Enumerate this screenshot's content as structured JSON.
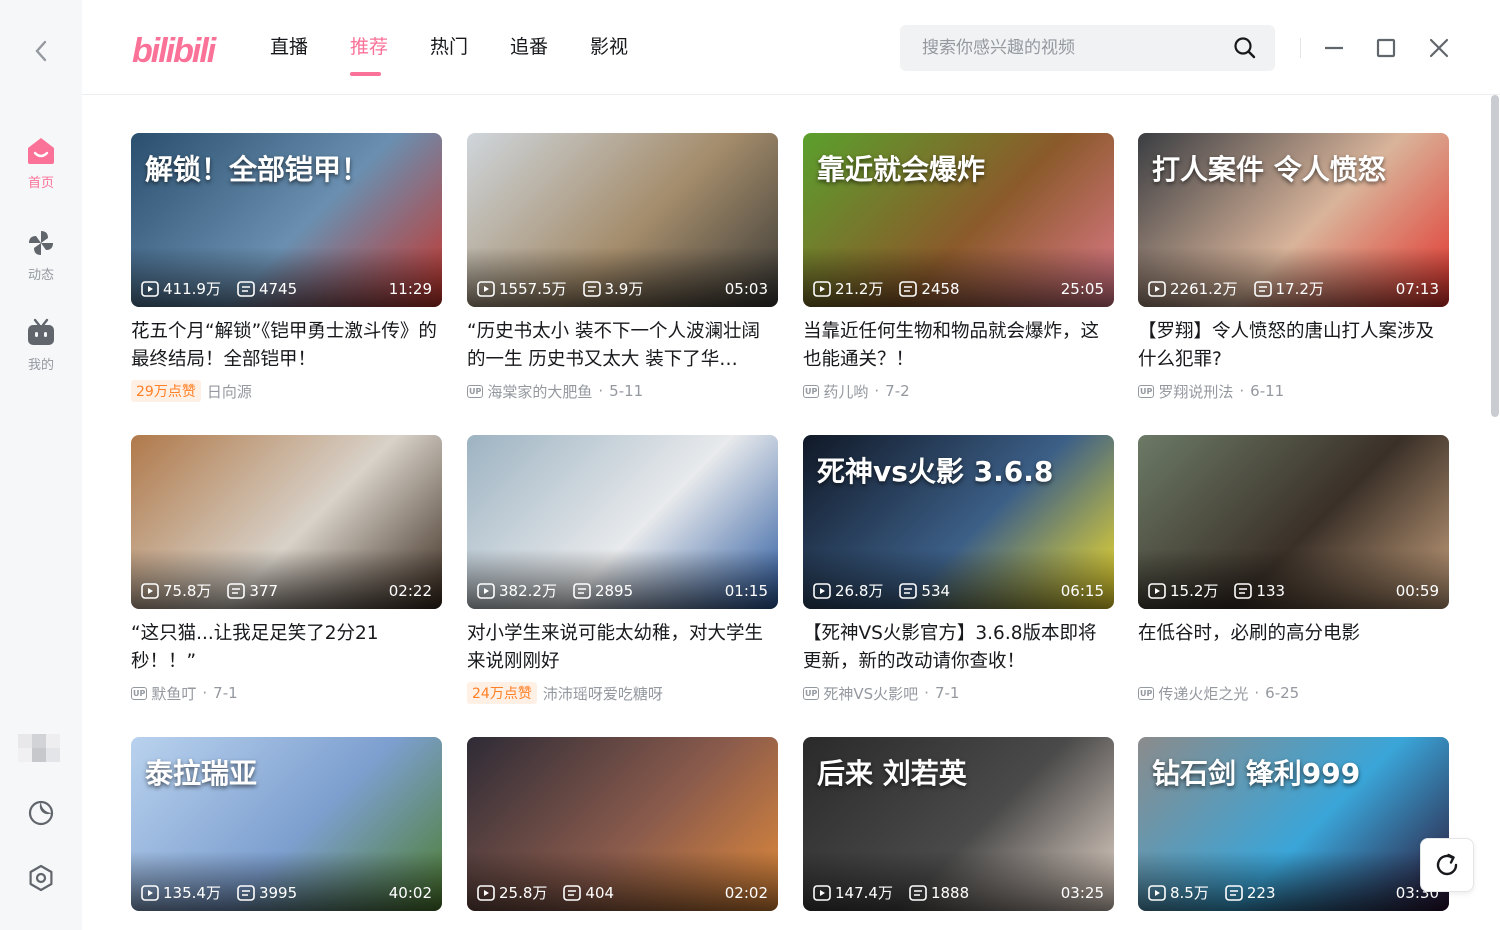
{
  "app": {
    "logo_text": "bilibili",
    "brand_color": "#fb7299"
  },
  "sidebar": {
    "back_icon": "chevron-left-icon",
    "items": [
      {
        "label": "首页",
        "icon": "home-tv-icon",
        "active": true
      },
      {
        "label": "动态",
        "icon": "pinwheel-icon",
        "active": false
      },
      {
        "label": "我的",
        "icon": "tv-face-icon",
        "active": false
      }
    ],
    "bottom_icons": [
      "theme-moon-icon",
      "settings-gear-icon"
    ]
  },
  "header": {
    "tabs": [
      {
        "label": "直播",
        "active": false
      },
      {
        "label": "推荐",
        "active": true
      },
      {
        "label": "热门",
        "active": false
      },
      {
        "label": "追番",
        "active": false
      },
      {
        "label": "影视",
        "active": false
      }
    ],
    "search": {
      "placeholder": "搜索你感兴趣的视频",
      "value": ""
    },
    "window_controls": [
      "minimize-icon",
      "maximize-icon",
      "close-icon"
    ]
  },
  "videos": [
    {
      "views": "411.9万",
      "danmaku": "4745",
      "duration": "11:29",
      "title": "花五个月“解锁”《铠甲勇士激斗传》的最终结局！全部铠甲！",
      "likes_badge": "29万点赞",
      "author": "日向源",
      "date": "",
      "thumb_text": "解锁！全部铠甲！",
      "thumb_colors": [
        "#2a4f6e",
        "#6a8fb0",
        "#c7342a"
      ]
    },
    {
      "views": "1557.5万",
      "danmaku": "3.9万",
      "duration": "05:03",
      "title": "“历史书太小 装不下一个人波澜壮阔的一生 历史书又太大 装下了华…",
      "likes_badge": "",
      "author": "海棠家的大肥鱼",
      "date": "5-11",
      "thumb_text": "",
      "thumb_colors": [
        "#cfd6dc",
        "#a48c6b",
        "#3b3a36"
      ]
    },
    {
      "views": "21.2万",
      "danmaku": "2458",
      "duration": "25:05",
      "title": "当靠近任何生物和物品就会爆炸，这也能通关？！",
      "likes_badge": "",
      "author": "药儿哟",
      "date": "7-2",
      "thumb_text": "靠近就会爆炸",
      "thumb_colors": [
        "#5aa02c",
        "#8b5a2b",
        "#e07a8c"
      ]
    },
    {
      "views": "2261.2万",
      "danmaku": "17.2万",
      "duration": "07:13",
      "title": "【罗翔】令人愤怒的唐山打人案涉及什么犯罪?",
      "likes_badge": "",
      "author": "罗翔说刑法",
      "date": "6-11",
      "thumb_text": "打人案件 令人愤怒",
      "thumb_colors": [
        "#3a3d42",
        "#d9b49a",
        "#e2322b"
      ]
    },
    {
      "views": "75.8万",
      "danmaku": "377",
      "duration": "02:22",
      "title": "“这只猫...让我足足笑了2分21秒！！”",
      "likes_badge": "",
      "author": "默鱼叮",
      "date": "7-1",
      "thumb_text": "",
      "thumb_colors": [
        "#b0794a",
        "#d8d2c9",
        "#3a2a1e"
      ]
    },
    {
      "views": "382.2万",
      "danmaku": "2895",
      "duration": "01:15",
      "title": "对小学生来说可能太幼稚，对大学生来说刚刚好",
      "likes_badge": "24万点赞",
      "author": "沛沛瑶呀爱吃糖呀",
      "date": "",
      "thumb_text": "",
      "thumb_colors": [
        "#9db3c2",
        "#e8eaec",
        "#2b5aa0"
      ]
    },
    {
      "views": "26.8万",
      "danmaku": "534",
      "duration": "06:15",
      "title": "【死神VS火影官方】3.6.8版本即将更新，新的改动请你查收！",
      "likes_badge": "",
      "author": "死神VS火影吧",
      "date": "7-1",
      "thumb_text": "死神vs火影 3.6.8",
      "thumb_colors": [
        "#101826",
        "#3c5f87",
        "#f6e02a"
      ]
    },
    {
      "views": "15.2万",
      "danmaku": "133",
      "duration": "00:59",
      "title": "在低谷时，必刷的高分电影",
      "likes_badge": "",
      "author": "传递火炬之光",
      "date": "6-25",
      "thumb_text": "",
      "thumb_colors": [
        "#6c7a66",
        "#3a3028",
        "#c9a27e"
      ]
    },
    {
      "views": "135.4万",
      "danmaku": "3995",
      "duration": "40:02",
      "title": "",
      "likes_badge": "",
      "author": "",
      "date": "",
      "thumb_text": "泰拉瑞亚",
      "thumb_colors": [
        "#b9d2ee",
        "#7d9fcf",
        "#4d7d2e"
      ]
    },
    {
      "views": "25.8万",
      "danmaku": "404",
      "duration": "02:02",
      "title": "",
      "likes_badge": "",
      "author": "",
      "date": "",
      "thumb_text": "",
      "thumb_colors": [
        "#2e2b36",
        "#8a5b4c",
        "#e28a3a"
      ]
    },
    {
      "views": "147.4万",
      "danmaku": "1888",
      "duration": "03:25",
      "title": "",
      "likes_badge": "",
      "author": "",
      "date": "",
      "thumb_text": "后来 刘若英",
      "thumb_colors": [
        "#2a2a2a",
        "#4a4a4a",
        "#e8d8cc"
      ]
    },
    {
      "views": "8.5万",
      "danmaku": "223",
      "duration": "03:30",
      "title": "",
      "likes_badge": "",
      "author": "",
      "date": "",
      "thumb_text": "钻石剑 锋利999",
      "thumb_colors": [
        "#8b8b8b",
        "#3aa5d8",
        "#2a0f2e"
      ]
    }
  ],
  "refresh_icon": "refresh-icon"
}
